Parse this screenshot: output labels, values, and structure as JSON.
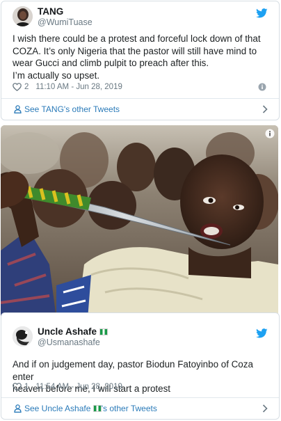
{
  "tweet1": {
    "display_name": "TANG",
    "handle": "@WumiTuase",
    "text_lines": [
      "I wish there could be a protest and forceful lock down of that",
      "COZA. It’s only Nigeria that the pastor will still have mind to",
      "wear Gucci and climb pulpit to preach after this.",
      "I’m actually so upset."
    ],
    "likes": "2",
    "timestamp": "11:10 AM - Jun 28, 2019",
    "footer_link": "See TANG's other Tweets",
    "icons": {
      "brand": "twitter-bird-icon",
      "like": "heart-icon",
      "info": "info-icon",
      "profile": "person-icon",
      "chevron": "chevron-right-icon"
    }
  },
  "tweet2": {
    "display_name": "Uncle Ashafe",
    "handle": "@Usmanashafe",
    "text_lines": [
      "And if on judgement day, pastor Biodun Fatoyinbo of Coza enter",
      "heaven before me, I will start a protest"
    ],
    "likes": "1",
    "timestamp": "11:54 AM - Jun 28, 2019",
    "footer_link_prefix": "See Uncle Ashafe ",
    "footer_link_suffix": "'s other Tweets",
    "icons": {
      "brand": "twitter-bird-icon",
      "flag": "nigeria-flag-icon",
      "like": "heart-icon",
      "profile": "person-icon",
      "chevron": "chevron-right-icon"
    }
  },
  "photo": {
    "subject": "man holding a spear blade to his mouth",
    "info_icon": "info-icon"
  },
  "colors": {
    "twitter_blue": "#1da1f2",
    "link_blue": "#2b7bb9",
    "secondary_text": "#697882",
    "border": "#d7dee4",
    "flag_green": "#1a9a49"
  }
}
